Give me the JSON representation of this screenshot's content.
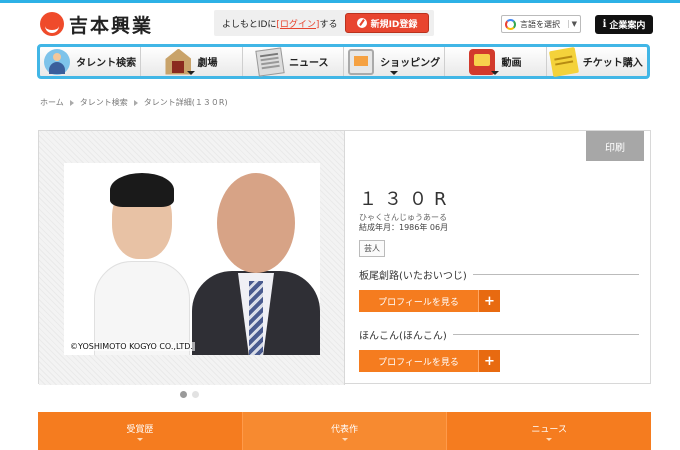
{
  "header": {
    "logo_text": "吉本興業",
    "login_prompt_prefix": "よしもとIDに",
    "login_link": "[ログイン]",
    "login_prompt_suffix": "する",
    "signup_label": "新規ID登録",
    "language_select": "言語を選択",
    "language_caret": "▼",
    "corporate_label": "企業案内",
    "corporate_icon_glyph": "i"
  },
  "nav": {
    "items": [
      {
        "label": "タレント検索",
        "icon": "talent-icon",
        "has_dropdown": false
      },
      {
        "label": "劇場",
        "icon": "theater-icon",
        "has_dropdown": true
      },
      {
        "label": "ニュース",
        "icon": "news-icon",
        "has_dropdown": false
      },
      {
        "label": "ショッピング",
        "icon": "shopping-icon",
        "has_dropdown": true
      },
      {
        "label": "動画",
        "icon": "video-icon",
        "has_dropdown": true
      },
      {
        "label": "チケット購入",
        "icon": "ticket-icon",
        "has_dropdown": false
      }
    ]
  },
  "breadcrumb": {
    "items": [
      "ホーム",
      "タレント検索",
      "タレント詳細(１３０R)"
    ]
  },
  "profile": {
    "print_label": "印刷",
    "name": "１３０R",
    "reading": "ひゃくさんじゅうあーる",
    "formed": "結成年月：1986年 06月",
    "tag": "芸人",
    "photo_copyright": "©YOSHIMOTO KOGYO CO.,LTD.",
    "members": [
      {
        "name": "板尾創路(いたおいつじ)",
        "button": "プロフィールを見る",
        "plus": "+"
      },
      {
        "name": "ほんこん(ほんこん)",
        "button": "プロフィールを見る",
        "plus": "+"
      }
    ]
  },
  "carousel": {
    "total": 2,
    "active": 1
  },
  "bottom_tabs": [
    "受賞歴",
    "代表作",
    "ニュース"
  ],
  "colors": {
    "accent": "#f57c1f",
    "nav_border": "#41b6e6",
    "signup": "#e8452f",
    "print": "#a7a7a7"
  }
}
